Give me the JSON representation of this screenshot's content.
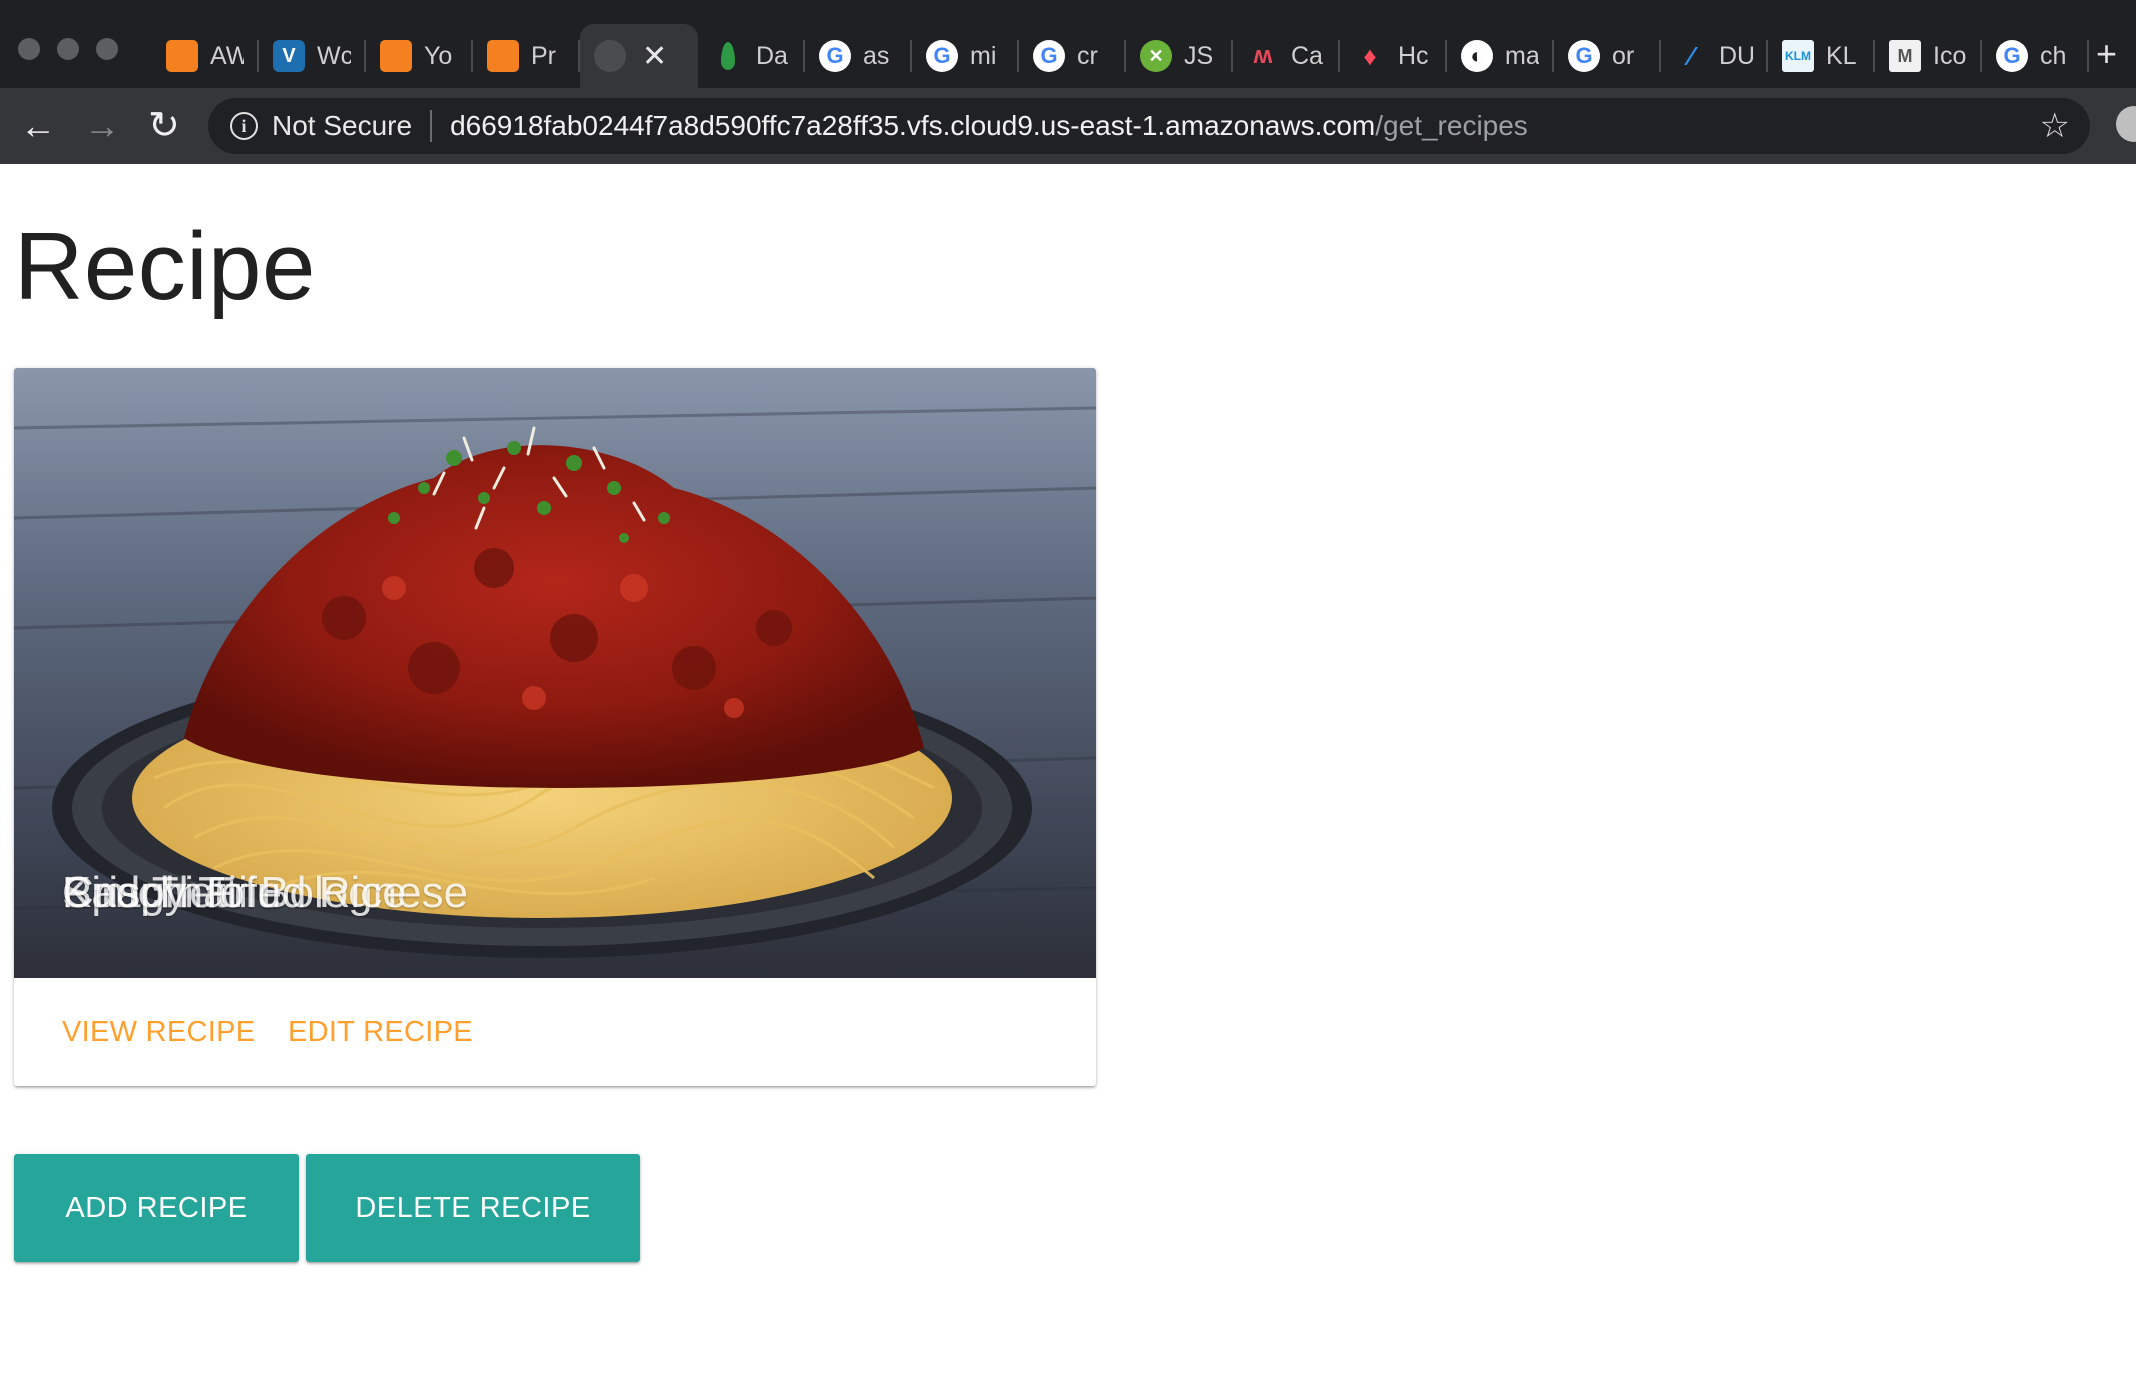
{
  "browser": {
    "tabs": [
      {
        "label": "AW",
        "icon": "aws-cube-icon"
      },
      {
        "label": "Wc",
        "icon": "v-logo-icon"
      },
      {
        "label": "Yo",
        "icon": "aws-cube-icon"
      },
      {
        "label": "Pr",
        "icon": "aws-cube-icon"
      },
      {
        "label": "",
        "icon": "globe-icon",
        "active": true
      },
      {
        "label": "Da",
        "icon": "leaf-icon"
      },
      {
        "label": "as",
        "icon": "google-icon"
      },
      {
        "label": "mi",
        "icon": "google-icon"
      },
      {
        "label": "cr",
        "icon": "google-icon"
      },
      {
        "label": "JS",
        "icon": "x-logo-icon"
      },
      {
        "label": "Ca",
        "icon": "wave-icon"
      },
      {
        "label": "Hc",
        "icon": "flame-icon"
      },
      {
        "label": "ma",
        "icon": "globe-icon"
      },
      {
        "label": "or",
        "icon": "google-icon"
      },
      {
        "label": "DU",
        "icon": "bird-icon"
      },
      {
        "label": "KL",
        "icon": "klm-icon"
      },
      {
        "label": "Ico",
        "icon": "m-logo-icon"
      },
      {
        "label": "ch",
        "icon": "google-icon"
      }
    ],
    "security_label": "Not Secure",
    "url_host": "d66918fab0244f7a8d590ffc7a28ff35.vfs.cloud9.us-east-1.amazonaws.com",
    "url_path": "/get_recipes"
  },
  "page": {
    "title": "Recipe",
    "card": {
      "overlapping_titles": [
        "Spaghetti Bolognese",
        "Kimchi Fried Rice",
        "Pad Thai",
        "Crispy Tofu"
      ],
      "view_label": "VIEW RECIPE",
      "edit_label": "EDIT RECIPE"
    },
    "add_label": "ADD RECIPE",
    "delete_label": "DELETE RECIPE"
  },
  "colors": {
    "accent_teal": "#26a69a",
    "link_orange": "#ff9f2e",
    "chrome_dark": "#1f2023",
    "toolbar": "#35363a"
  }
}
